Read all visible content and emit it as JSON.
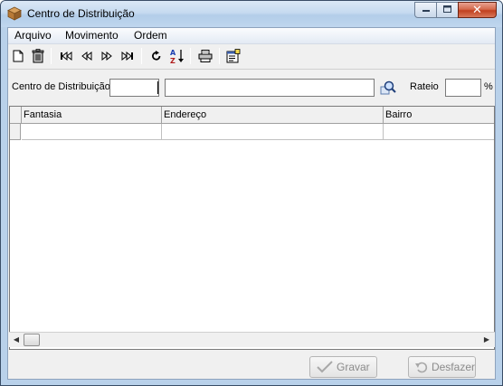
{
  "window": {
    "title": "Centro de Distribuição",
    "controls": {
      "minimize": "minimize",
      "maximize": "maximize",
      "close": "close"
    }
  },
  "menu": {
    "items": [
      {
        "label": "Arquivo"
      },
      {
        "label": "Movimento"
      },
      {
        "label": "Ordem"
      }
    ]
  },
  "toolbar": {
    "buttons": [
      {
        "icon": "new-document-icon"
      },
      {
        "icon": "delete-icon"
      },
      {
        "icon": "first-record-icon"
      },
      {
        "icon": "previous-record-icon"
      },
      {
        "icon": "next-record-icon"
      },
      {
        "icon": "last-record-icon"
      },
      {
        "icon": "refresh-icon"
      },
      {
        "icon": "sort-az-icon"
      },
      {
        "icon": "print-icon"
      },
      {
        "icon": "properties-icon"
      }
    ]
  },
  "filter": {
    "cd_label": "Centro de Distribuição",
    "cd_code": "",
    "cd_name": "",
    "rateio_label": "Rateio",
    "rateio_value": "",
    "percent": "%"
  },
  "grid": {
    "columns": [
      {
        "label": "Fantasia"
      },
      {
        "label": "Endereço"
      },
      {
        "label": "Bairro"
      }
    ]
  },
  "actions": {
    "save_label": "Gravar",
    "undo_label": "Desfazer"
  }
}
